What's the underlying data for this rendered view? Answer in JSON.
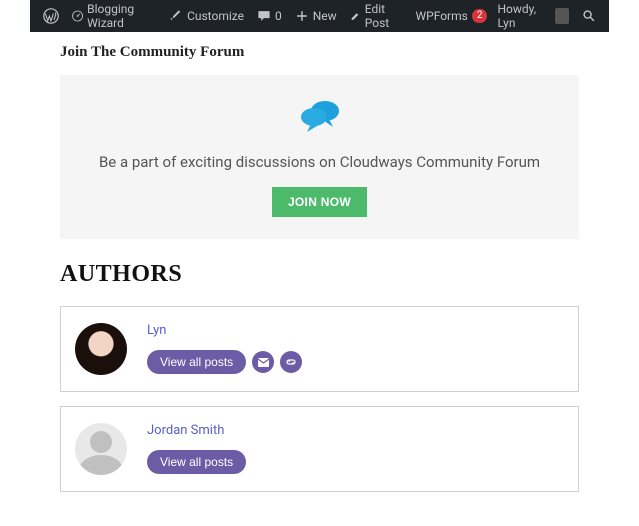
{
  "adminbar": {
    "site_name": "Blogging Wizard",
    "customize": "Customize",
    "comments_count": "0",
    "new": "New",
    "edit_post": "Edit Post",
    "wpforms": "WPForms",
    "wpforms_badge": "2",
    "howdy": "Howdy, Lyn"
  },
  "forum": {
    "title": "Join The Community Forum",
    "description": "Be a part of exciting discussions on Cloudways Community Forum",
    "button": "JOIN NOW"
  },
  "authors": {
    "heading": "AUTHORS",
    "list": [
      {
        "name": "Lyn",
        "view_all": "View all posts",
        "has_email": true,
        "has_link": true
      },
      {
        "name": "Jordan Smith",
        "view_all": "View all posts",
        "has_email": false,
        "has_link": false
      }
    ]
  }
}
